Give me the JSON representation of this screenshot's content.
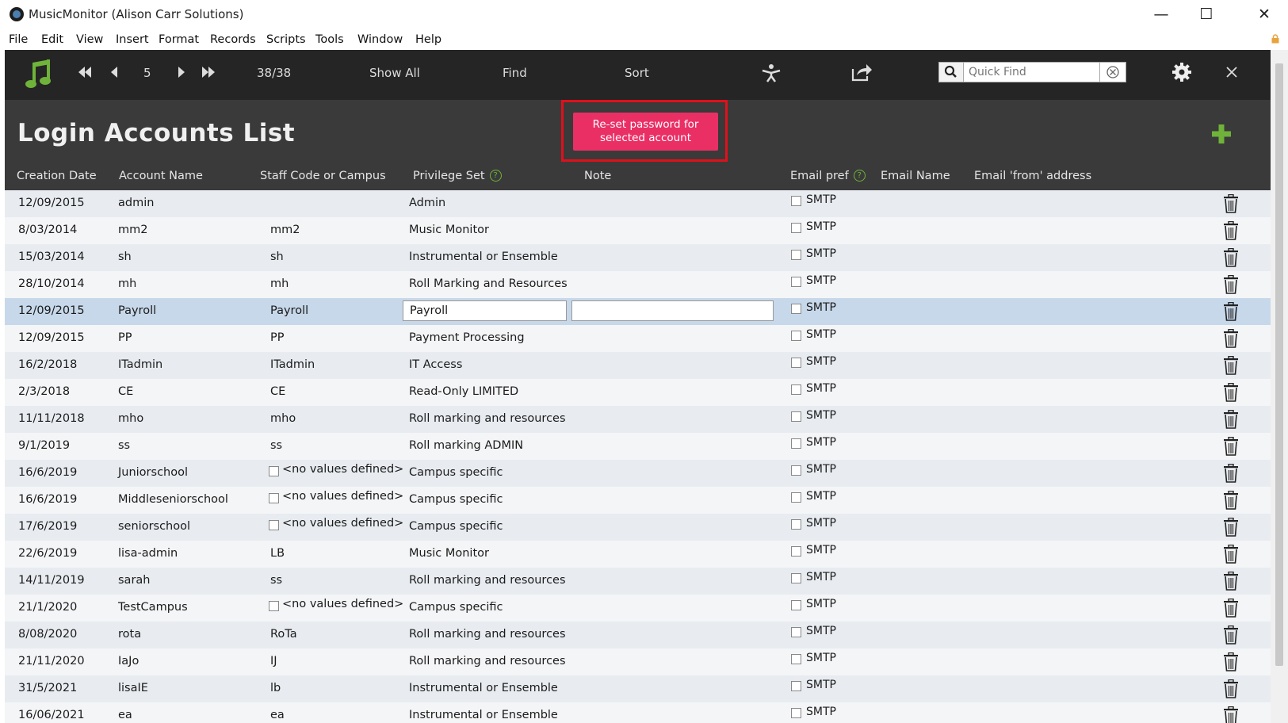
{
  "window": {
    "title": "MusicMonitor (Alison Carr Solutions)"
  },
  "menu": [
    "File",
    "Edit",
    "View",
    "Insert",
    "Format",
    "Records",
    "Scripts",
    "Tools",
    "Window",
    "Help"
  ],
  "toolbar": {
    "record_number": "5",
    "record_count": "38/38",
    "show_all": "Show All",
    "find": "Find",
    "sort": "Sort",
    "quick_find_placeholder": "Quick Find"
  },
  "header": {
    "title": "Login Accounts List",
    "reset_button": "Re-set password for selected account"
  },
  "columns": {
    "creation_date": "Creation Date",
    "account_name": "Account Name",
    "staff_code": "Staff Code or Campus",
    "privilege_set": "Privilege Set",
    "note": "Note",
    "email_pref": "Email pref",
    "email_name": "Email Name",
    "email_from": "Email 'from' address"
  },
  "smtp_label": "SMTP",
  "no_values_label": "<no values defined>",
  "rows": [
    {
      "date": "12/09/2015",
      "account": "admin",
      "staff": "",
      "privilege": "Admin"
    },
    {
      "date": "8/03/2014",
      "account": "mm2",
      "staff": "mm2",
      "privilege": "Music Monitor"
    },
    {
      "date": "15/03/2014",
      "account": "sh",
      "staff": "sh",
      "privilege": "Instrumental or Ensemble"
    },
    {
      "date": "28/10/2014",
      "account": "mh",
      "staff": "mh",
      "privilege": "Roll Marking and Resources"
    },
    {
      "date": "12/09/2015",
      "account": "Payroll",
      "staff": "Payroll",
      "privilege": "Payroll",
      "selected": true
    },
    {
      "date": "12/09/2015",
      "account": "PP",
      "staff": "PP",
      "privilege": "Payment Processing"
    },
    {
      "date": "16/2/2018",
      "account": "ITadmin",
      "staff": "ITadmin",
      "privilege": "IT Access"
    },
    {
      "date": "2/3/2018",
      "account": "CE",
      "staff": "CE",
      "privilege": "Read-Only LIMITED"
    },
    {
      "date": "11/11/2018",
      "account": "mho",
      "staff": "mho",
      "privilege": "Roll marking and resources"
    },
    {
      "date": "9/1/2019",
      "account": "ss",
      "staff": "ss",
      "privilege": "Roll marking ADMIN"
    },
    {
      "date": "16/6/2019",
      "account": "Juniorschool",
      "staff": null,
      "privilege": "Campus specific"
    },
    {
      "date": "16/6/2019",
      "account": "Middleseniorschool",
      "staff": null,
      "privilege": "Campus specific"
    },
    {
      "date": "17/6/2019",
      "account": "seniorschool",
      "staff": null,
      "privilege": "Campus specific"
    },
    {
      "date": "22/6/2019",
      "account": "lisa-admin",
      "staff": "LB",
      "privilege": "Music Monitor"
    },
    {
      "date": "14/11/2019",
      "account": "sarah",
      "staff": "ss",
      "privilege": "Roll marking and resources"
    },
    {
      "date": "21/1/2020",
      "account": "TestCampus",
      "staff": null,
      "privilege": "Campus specific"
    },
    {
      "date": "8/08/2020",
      "account": "rota",
      "staff": "RoTa",
      "privilege": "Roll marking and resources"
    },
    {
      "date": "21/11/2020",
      "account": "IaJo",
      "staff": "IJ",
      "privilege": "Roll marking and resources"
    },
    {
      "date": "31/5/2021",
      "account": "lisaIE",
      "staff": "lb",
      "privilege": "Instrumental or Ensemble"
    },
    {
      "date": "16/06/2021",
      "account": "ea",
      "staff": "ea",
      "privilege": "Instrumental or Ensemble"
    }
  ],
  "colors": {
    "toolbar_bg": "#252525",
    "header_bg": "#3a3a3a",
    "accent_button": "#ea2f65",
    "highlight_border": "#e0101b",
    "icon_green": "#6fb33a",
    "selected_row": "#c7d8ea"
  }
}
